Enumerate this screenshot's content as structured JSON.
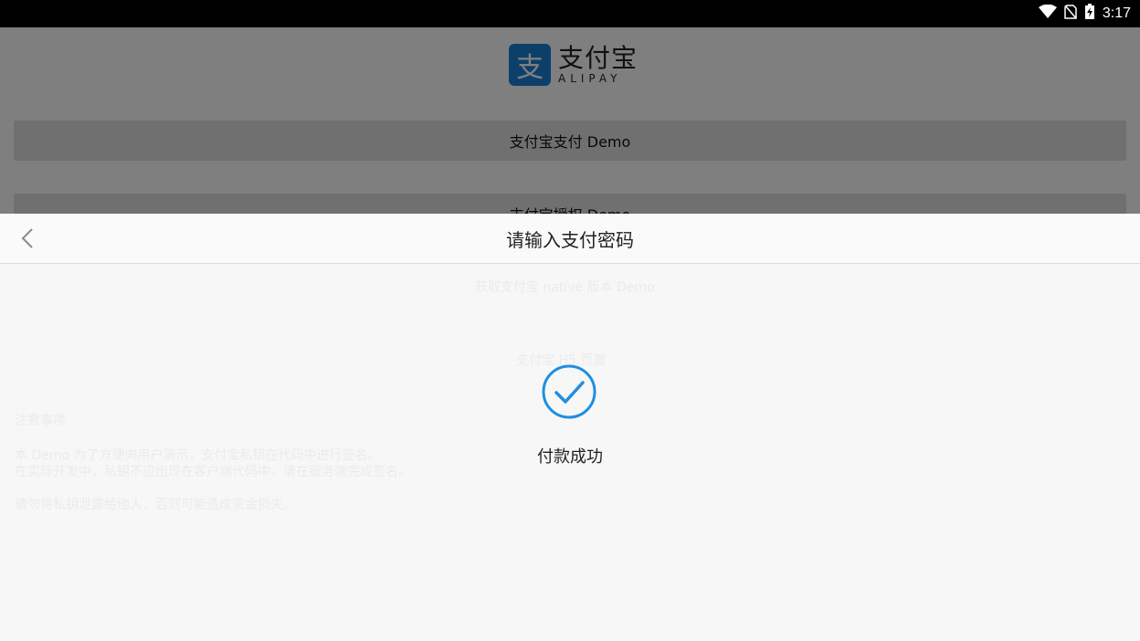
{
  "status_bar": {
    "time": "3:17",
    "icons": [
      "wifi-icon",
      "no-sim-icon",
      "battery-charging-icon"
    ]
  },
  "background": {
    "logo": {
      "cn": "支付宝",
      "en": "ALIPAY"
    },
    "buttons": [
      "支付宝支付 Demo",
      "支付宝授权 Demo",
      "获取支付宝 native 版本 Demo",
      "支付宝 H5 页面"
    ],
    "notes_title": "注意事项",
    "notes": [
      "本 Demo 为了方便向用户演示，支付宝私钥在代码中进行签名。",
      "在实际开发中，私钥不应出现在客户端代码中，请在服务端完成签名。",
      "请勿将私钥泄露给他人，否则可能造成资金损失。"
    ]
  },
  "dialog": {
    "title": "请输入支付密码",
    "success_text": "付款成功",
    "accent": "#1f8fe0"
  }
}
